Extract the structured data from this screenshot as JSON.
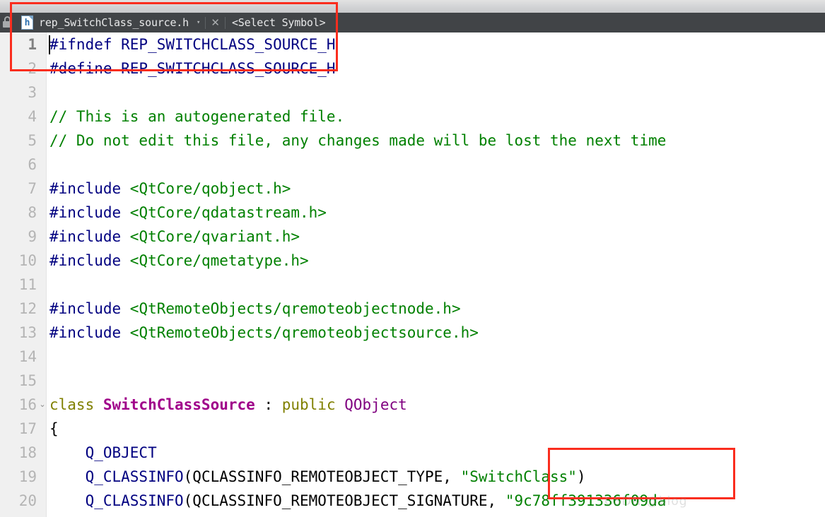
{
  "window": {
    "top_strip_color": "#d2d3d5",
    "tabbar_color": "#414447"
  },
  "tabbar": {
    "lock_icon": "lock-icon",
    "file_icon_glyph": "h",
    "tab_title": "rep_SwitchClass_source.h",
    "chevron": "▾",
    "close_label": "✕",
    "symbol_selector": "<Select Symbol>"
  },
  "editor": {
    "gutter_bg": "#f0f0f0",
    "current_line": 1,
    "fold_marker": "⌄",
    "lines": [
      {
        "n": "1",
        "fold": false,
        "current": true,
        "tokens": [
          {
            "t": "#ifndef REP_SWITCHCLASS_SOURCE_H",
            "c": "tok-pre"
          }
        ]
      },
      {
        "n": "2",
        "fold": false,
        "current": false,
        "tokens": [
          {
            "t": "#define REP_SWITCHCLASS_SOURCE_H",
            "c": "tok-pre"
          }
        ]
      },
      {
        "n": "3",
        "fold": false,
        "current": false,
        "tokens": []
      },
      {
        "n": "4",
        "fold": false,
        "current": false,
        "tokens": [
          {
            "t": "// This is an autogenerated file.",
            "c": "tok-com"
          }
        ]
      },
      {
        "n": "5",
        "fold": false,
        "current": false,
        "tokens": [
          {
            "t": "// Do not edit this file, any changes made will be lost the next time",
            "c": "tok-com"
          }
        ]
      },
      {
        "n": "6",
        "fold": false,
        "current": false,
        "tokens": []
      },
      {
        "n": "7",
        "fold": false,
        "current": false,
        "tokens": [
          {
            "t": "#include ",
            "c": "tok-pre"
          },
          {
            "t": "<QtCore/qobject.h>",
            "c": "tok-inc"
          }
        ]
      },
      {
        "n": "8",
        "fold": false,
        "current": false,
        "tokens": [
          {
            "t": "#include ",
            "c": "tok-pre"
          },
          {
            "t": "<QtCore/qdatastream.h>",
            "c": "tok-inc"
          }
        ]
      },
      {
        "n": "9",
        "fold": false,
        "current": false,
        "tokens": [
          {
            "t": "#include ",
            "c": "tok-pre"
          },
          {
            "t": "<QtCore/qvariant.h>",
            "c": "tok-inc"
          }
        ]
      },
      {
        "n": "10",
        "fold": false,
        "current": false,
        "tokens": [
          {
            "t": "#include ",
            "c": "tok-pre"
          },
          {
            "t": "<QtCore/qmetatype.h>",
            "c": "tok-inc"
          }
        ]
      },
      {
        "n": "11",
        "fold": false,
        "current": false,
        "tokens": []
      },
      {
        "n": "12",
        "fold": false,
        "current": false,
        "tokens": [
          {
            "t": "#include ",
            "c": "tok-pre"
          },
          {
            "t": "<QtRemoteObjects/qremoteobjectnode.h>",
            "c": "tok-inc"
          }
        ]
      },
      {
        "n": "13",
        "fold": false,
        "current": false,
        "tokens": [
          {
            "t": "#include ",
            "c": "tok-pre"
          },
          {
            "t": "<QtRemoteObjects/qremoteobjectsource.h>",
            "c": "tok-inc"
          }
        ]
      },
      {
        "n": "14",
        "fold": false,
        "current": false,
        "tokens": []
      },
      {
        "n": "15",
        "fold": false,
        "current": false,
        "tokens": []
      },
      {
        "n": "16",
        "fold": true,
        "current": false,
        "tokens": [
          {
            "t": "class ",
            "c": "tok-kw"
          },
          {
            "t": "SwitchClassSource",
            "c": "tok-cls"
          },
          {
            "t": " : ",
            "c": "tok-punct"
          },
          {
            "t": "public ",
            "c": "tok-kw"
          },
          {
            "t": "QObject",
            "c": "tok-type"
          }
        ]
      },
      {
        "n": "17",
        "fold": false,
        "current": false,
        "tokens": [
          {
            "t": "{",
            "c": "tok-punct"
          }
        ]
      },
      {
        "n": "18",
        "fold": false,
        "current": false,
        "tokens": [
          {
            "t": "    ",
            "c": "tok-punct"
          },
          {
            "t": "Q_OBJECT",
            "c": "tok-macro"
          }
        ]
      },
      {
        "n": "19",
        "fold": false,
        "current": false,
        "tokens": [
          {
            "t": "    ",
            "c": "tok-punct"
          },
          {
            "t": "Q_CLASSINFO",
            "c": "tok-macro"
          },
          {
            "t": "(QCLASSINFO_REMOTEOBJECT_TYPE, ",
            "c": "tok-punct"
          },
          {
            "t": "\"SwitchClass\"",
            "c": "tok-str"
          },
          {
            "t": ")",
            "c": "tok-punct"
          }
        ]
      },
      {
        "n": "20",
        "fold": false,
        "current": false,
        "tokens": [
          {
            "t": "    ",
            "c": "tok-punct"
          },
          {
            "t": "Q_CLASSINFO",
            "c": "tok-macro"
          },
          {
            "t": "(QCLASSINFO_REMOTEOBJECT_SIGNATURE, ",
            "c": "tok-punct"
          },
          {
            "t": "\"9c78ff391336f09da",
            "c": "tok-str"
          }
        ]
      }
    ]
  },
  "annotations": {
    "tab_box_color": "#fa2d1e",
    "string_box_color": "#fa2d1e"
  },
  "watermark": {
    "text": "CSDN @blog"
  }
}
